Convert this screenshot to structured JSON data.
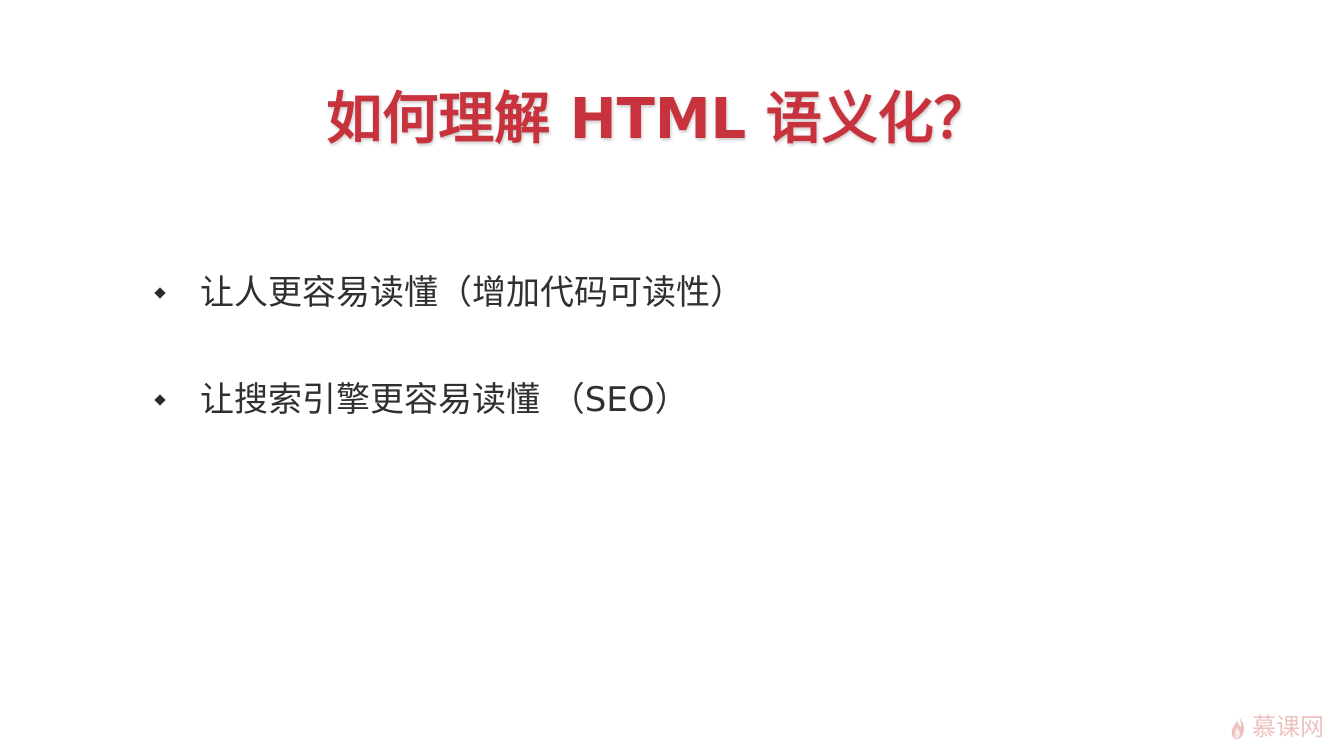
{
  "slide": {
    "title": "如何理解 HTML 语义化？",
    "bullets": [
      "让人更容易读懂（增加代码可读性）",
      "让搜索引擎更容易读懂 （SEO）"
    ],
    "watermark": {
      "text": "慕课网",
      "icon": "flame-icon"
    },
    "colors": {
      "title": "#c8323d",
      "text": "#303030",
      "watermark": "#d86d6d"
    }
  }
}
